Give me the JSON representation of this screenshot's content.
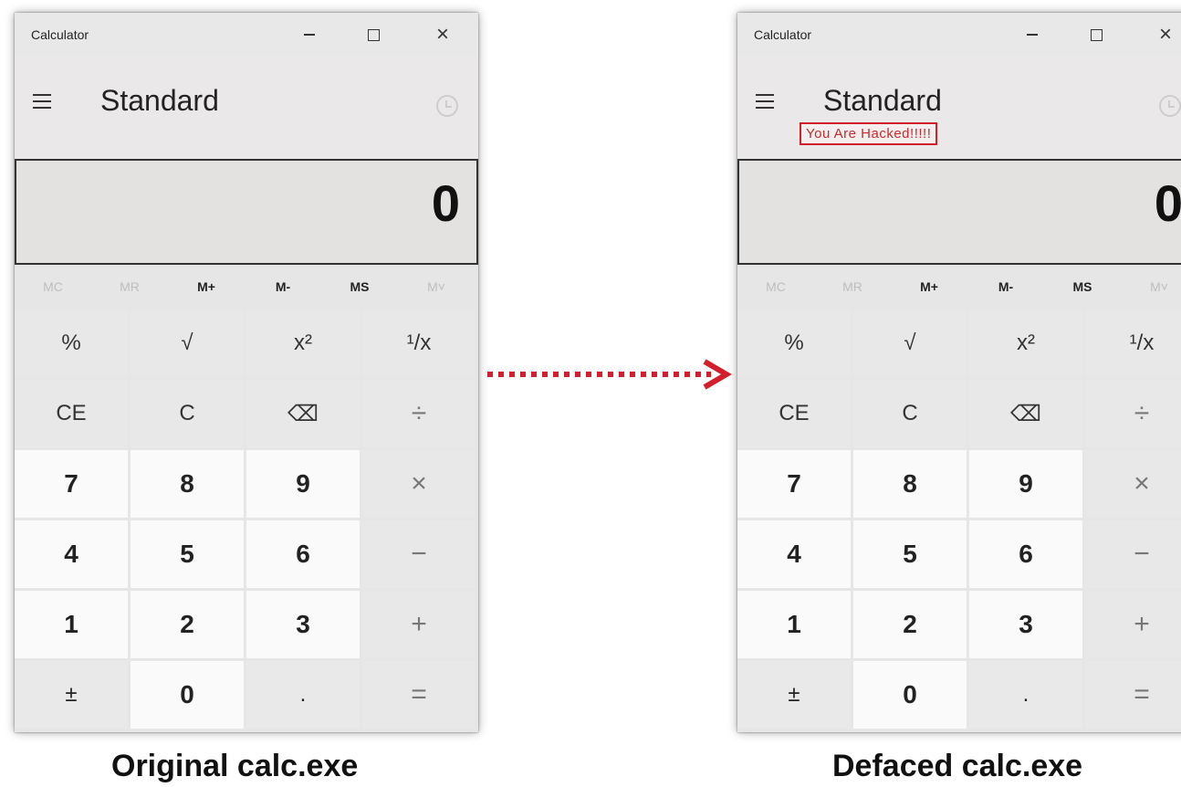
{
  "calculators": [
    {
      "title": "Calculator",
      "mode": "Standard",
      "display": "0",
      "overlay_text": ""
    },
    {
      "title": "Calculator",
      "mode": "Standard",
      "display": "0",
      "overlay_text": "You Are Hacked!!!!!"
    }
  ],
  "memory_buttons": [
    {
      "label": "MC",
      "enabled": false
    },
    {
      "label": "MR",
      "enabled": false
    },
    {
      "label": "M+",
      "enabled": true
    },
    {
      "label": "M-",
      "enabled": true
    },
    {
      "label": "MS",
      "enabled": true
    },
    {
      "label": "M˅",
      "enabled": false
    }
  ],
  "keys": [
    {
      "label": "%",
      "kind": "fn"
    },
    {
      "label": "√",
      "kind": "fn"
    },
    {
      "label": "x²",
      "kind": "fn"
    },
    {
      "label": "¹/x",
      "kind": "fn"
    },
    {
      "label": "CE",
      "kind": "fn"
    },
    {
      "label": "C",
      "kind": "fn"
    },
    {
      "label": "⌫",
      "kind": "fn"
    },
    {
      "label": "÷",
      "kind": "op"
    },
    {
      "label": "7",
      "kind": "num"
    },
    {
      "label": "8",
      "kind": "num"
    },
    {
      "label": "9",
      "kind": "num"
    },
    {
      "label": "×",
      "kind": "op"
    },
    {
      "label": "4",
      "kind": "num"
    },
    {
      "label": "5",
      "kind": "num"
    },
    {
      "label": "6",
      "kind": "num"
    },
    {
      "label": "−",
      "kind": "op"
    },
    {
      "label": "1",
      "kind": "num"
    },
    {
      "label": "2",
      "kind": "num"
    },
    {
      "label": "3",
      "kind": "num"
    },
    {
      "label": "+",
      "kind": "op"
    },
    {
      "label": "±",
      "kind": "bottom"
    },
    {
      "label": "0",
      "kind": "zero"
    },
    {
      "label": ".",
      "kind": "bottom"
    },
    {
      "label": "=",
      "kind": "op"
    }
  ],
  "captions": {
    "left": "Original calc.exe",
    "right": "Defaced calc.exe"
  },
  "colors": {
    "arrow": "#d21f2b",
    "hacked_border": "#d21f2b"
  }
}
